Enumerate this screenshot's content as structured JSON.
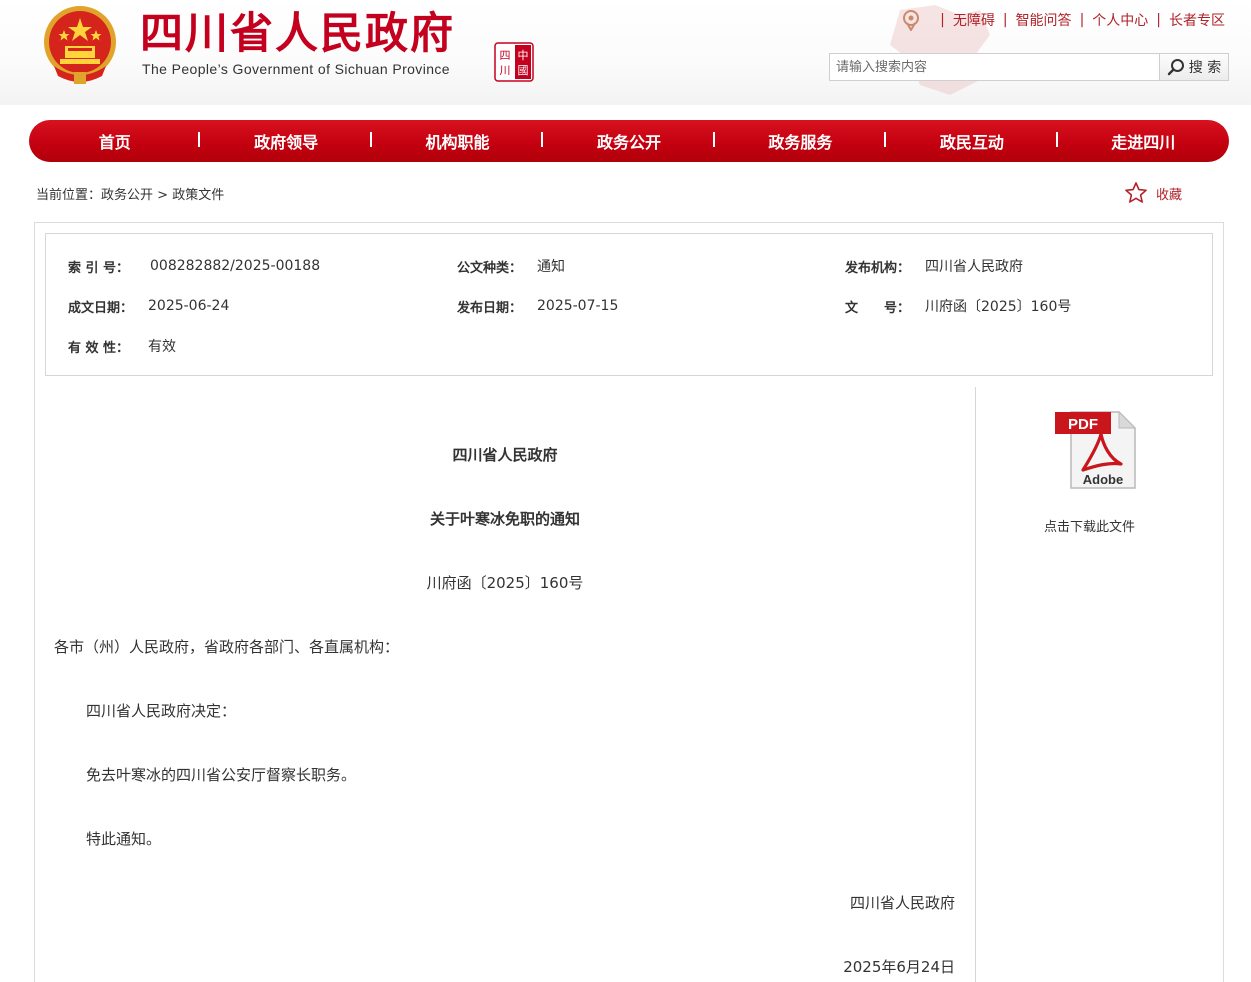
{
  "header": {
    "title": "四川省人民政府",
    "subtitle": "The People’s Government of Sichuan Province",
    "seal_text": "中國四川",
    "links": [
      "无障碍",
      "智能问答",
      "个人中心",
      "长者专区"
    ],
    "search_placeholder": "请输入搜索内容",
    "search_button": "搜 索"
  },
  "nav": {
    "items": [
      "首页",
      "政府领导",
      "机构职能",
      "政务公开",
      "政务服务",
      "政民互动",
      "走进四川"
    ]
  },
  "breadcrumb": {
    "prefix": "当前位置：",
    "items": [
      "政务公开",
      "政策文件"
    ],
    "separator": " > ",
    "favorite": "收藏"
  },
  "meta": {
    "index_label": "索 引 号：",
    "index_value": "008282882/2025-00188",
    "type_label": "公文种类：",
    "type_value": "通知",
    "publisher_label": "发布机构：",
    "publisher_value": "四川省人民政府",
    "written_label": "成文日期：",
    "written_value": "2025-06-24",
    "published_label": "发布日期：",
    "published_value": "2025-07-15",
    "docno_label": "文　　号：",
    "docno_value": "川府函〔2025〕160号",
    "validity_label": "有 效 性：",
    "validity_value": "有效"
  },
  "document": {
    "issuer": "四川省人民政府",
    "title": "关于叶寒冰免职的通知",
    "number": "川府函〔2025〕160号",
    "salutation": "各市（州）人民政府，省政府各部门、各直属机构：",
    "para1": "四川省人民政府决定：",
    "para2": "免去叶寒冰的四川省公安厅督察长职务。",
    "para3": "特此通知。",
    "signature": "四川省人民政府",
    "date": "2025年6月24日"
  },
  "download": {
    "pdf_label": "PDF",
    "adobe_label": "Adobe",
    "text": "点击下载此文件"
  },
  "colors": {
    "brand_red": "#c4001f",
    "nav_red": "#c3000f",
    "link_red": "#b0232b"
  }
}
